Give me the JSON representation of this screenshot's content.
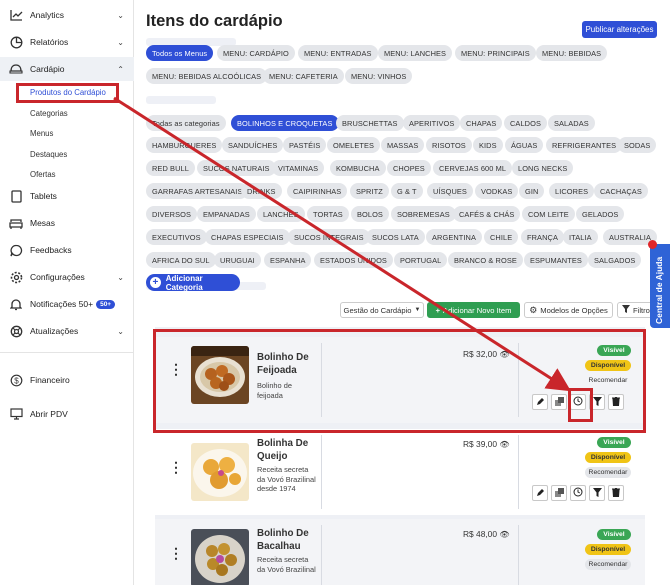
{
  "sidebar": {
    "items": [
      {
        "label": "Analytics",
        "icon": "analytics-chart-icon"
      },
      {
        "label": "Relatórios",
        "icon": "pie-chart-icon"
      },
      {
        "label": "Cardápio",
        "icon": "hat-icon"
      },
      {
        "label": "Tablets",
        "icon": "tablet-icon"
      },
      {
        "label": "Mesas",
        "icon": "sofa-icon"
      },
      {
        "label": "Feedbacks",
        "icon": "chat-icon"
      },
      {
        "label": "Configurações",
        "icon": "gear-icon"
      },
      {
        "label": "Notificações 50+",
        "icon": "bell-icon",
        "badge": "50+"
      },
      {
        "label": "Atualizações",
        "icon": "lifebuoy-icon"
      },
      {
        "label": "Financeiro",
        "icon": "dollar-icon"
      },
      {
        "label": "Abrir PDV",
        "icon": "monitor-icon"
      }
    ],
    "sub_items": [
      "Produtos do Cardápio",
      "Categorias",
      "Menus",
      "Destaques",
      "Ofertas"
    ]
  },
  "header": {
    "title": "Itens do cardápio",
    "publish_label": "Publicar alterações"
  },
  "menus": [
    "Todos os Menus",
    "MENU: CARDÁPIO",
    "MENU: ENTRADAS",
    "MENU: LANCHES",
    "MENU: PRINCIPAIS",
    "MENU: BEBIDAS",
    "MENU: BEBIDAS ALCOÓLICAS",
    "MENU: CAFETERIA",
    "MENU: VINHOS"
  ],
  "categories": [
    "Todas as categorias",
    "BOLINHOS E CROQUETAS",
    "BRUSCHETTAS",
    "APERITIVOS",
    "CHAPAS",
    "CALDOS",
    "SALADAS",
    "HAMBURGUERES",
    "SANDUÍCHES",
    "PASTÉIS",
    "OMELETES",
    "MASSAS",
    "RISOTOS",
    "KIDS",
    "ÁGUAS",
    "REFRIGERANTES",
    "SODAS",
    "RED BULL",
    "SUCOS NATURAIS",
    "VITAMINAS",
    "KOMBUCHA",
    "CHOPES",
    "CERVEJAS 600 ML",
    "LONG NECKS",
    "GARRAFAS ARTESANAIS",
    "DRINKS",
    "CAIPIRINHAS",
    "SPRITZ",
    "G & T",
    "UÍSQUES",
    "VODKAS",
    "GIN",
    "LICORES",
    "CACHAÇAS",
    "DIVERSOS",
    "EMPANADAS",
    "LANCHES",
    "TORTAS",
    "BOLOS",
    "SOBREMESAS",
    "CAFÉS & CHÁS",
    "COM LEITE",
    "GELADOS",
    "EXECUTIVOS",
    "CHAPAS ESPECIAIS",
    "SUCOS INTEGRAIS",
    "SUCOS LATA",
    "ARGENTINA",
    "CHILE",
    "FRANÇA",
    "ITALIA",
    "AUSTRALIA",
    "AFRICA DO SUL",
    "URUGUAI",
    "ESPANHA",
    "ESTADOS UNIDOS",
    "PORTUGAL",
    "BRANCO & ROSE",
    "ESPUMANTES",
    "SALGADOS"
  ],
  "add_category_label": "Adicionar Categoria",
  "toolbar": {
    "gestao": "Gestão do Cardápio",
    "add_item": "Adicionar Novo Item",
    "modelos": "Modelos de Opções",
    "filtro": "Filtro"
  },
  "products": [
    {
      "name": "Bolinho De Feijoada",
      "desc": "Bolinho de feijoada",
      "price": "R$ 32,00"
    },
    {
      "name": "Bolinha De Queijo",
      "desc": "Receita secreta da Vovó Brazilinal desde 1974",
      "price": "R$ 39,00"
    },
    {
      "name": "Bolinho De Bacalhau",
      "desc": "Receita secreta da Vovó Brazilinal",
      "price": "R$ 48,00"
    }
  ],
  "status": {
    "visivel": "Visível",
    "disponivel": "Disponível",
    "recomendar": "Recomendar"
  },
  "help_tab": "Central de Ajuda",
  "colors": {
    "primary": "#2f4fd6",
    "green": "#2f9e52",
    "highlight": "#c9262b",
    "yellow": "#f0c416"
  }
}
